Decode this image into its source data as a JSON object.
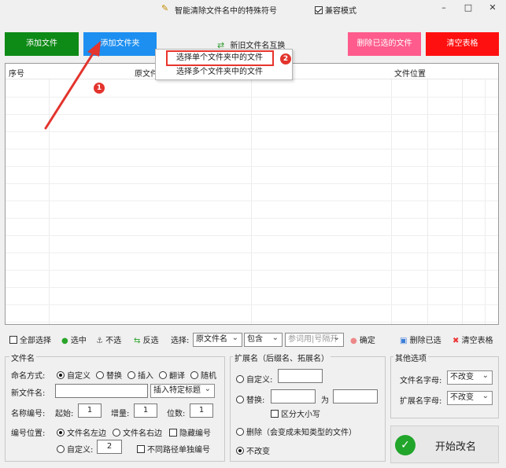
{
  "titlebar": {
    "title": "智能清除文件名中的特殊符号",
    "compat_label": "兼容模式",
    "compat_checked": true,
    "min": "–",
    "max": "□",
    "close": "✕"
  },
  "toolbar": {
    "add_file": "添加文件",
    "add_folder": "添加文件夹",
    "swap_names": "新旧文件名互换",
    "delete_selected": "删除已选的文件",
    "clear_table": "清空表格",
    "colors": {
      "green": "#0e8a16",
      "blue": "#1d8ff0",
      "pink": "#ff5b8c",
      "red": "#ff1010"
    }
  },
  "dropdown": {
    "items": [
      "选择单个文件夹中的文件",
      "选择多个文件夹中的文件"
    ]
  },
  "annotations": {
    "badge1": "1",
    "badge2": "2"
  },
  "table": {
    "columns": [
      "序号",
      "原文件",
      "文件位置"
    ]
  },
  "bottom_bar": {
    "select_all": "全部选择",
    "select": "选中",
    "unselect": "不选",
    "invert": "反选",
    "choose_label": "选择:",
    "field_value": "原文件名",
    "match_value": "包含",
    "search_placeholder": "参词用|号隔开",
    "confirm": "确定",
    "delete_selected": "删除已选",
    "clear_table": "清空表格"
  },
  "filename_group": {
    "title": "文件名",
    "mode_label": "命名方式:",
    "modes": [
      "自定义",
      "替换",
      "插入",
      "翻译",
      "随机"
    ],
    "new_name_label": "新文件名:",
    "new_name_value": "",
    "insert_tag": "插入特定标题",
    "numbering_label": "名称编号:",
    "start_label": "起始:",
    "start_value": "1",
    "step_label": "增量:",
    "step_value": "1",
    "digits_label": "位数:",
    "digits_value": "1",
    "position_label": "编号位置:",
    "pos_left": "文件名左边",
    "pos_right": "文件名右边",
    "hide_number": "隐藏编号",
    "custom_label": "自定义:",
    "custom_value": "2",
    "separate_paths": "不同路径单独编号"
  },
  "ext_group": {
    "title": "扩展名（后缀名、拓展名）",
    "custom": "自定义:",
    "replace": "替换:",
    "to": "为",
    "case_sensitive": "区分大小写",
    "delete": "删除（会变成未知类型的文件）",
    "keep": "不改变"
  },
  "other_group": {
    "title": "其他选项",
    "name_case_label": "文件名字母:",
    "name_case_value": "不改变",
    "ext_case_label": "扩展名字母:",
    "ext_case_value": "不改变"
  },
  "start_button": {
    "label": "开始改名"
  }
}
